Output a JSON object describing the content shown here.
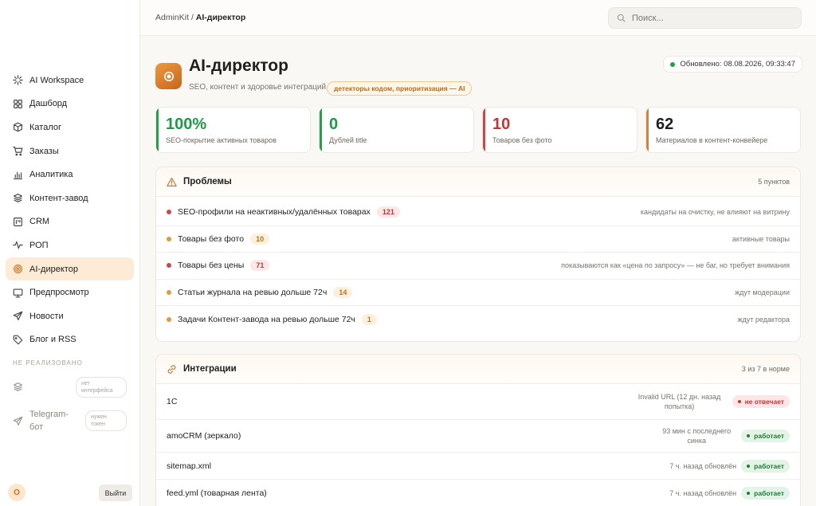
{
  "breadcrumb": {
    "root": "AdminKit",
    "sep": "/",
    "current": "AI-директор"
  },
  "search": {
    "placeholder": "Поиск..."
  },
  "sidebar": {
    "items": [
      {
        "label": "AI Workspace",
        "icon": "sparkle-icon"
      },
      {
        "label": "Дашборд",
        "icon": "grid-icon"
      },
      {
        "label": "Каталог",
        "icon": "box-icon"
      },
      {
        "label": "Заказы",
        "icon": "cart-icon"
      },
      {
        "label": "Аналитика",
        "icon": "bar-chart-icon"
      },
      {
        "label": "Контент-завод",
        "icon": "layers-icon"
      },
      {
        "label": "CRM",
        "icon": "kanban-icon"
      },
      {
        "label": "РОП",
        "icon": "pulse-icon"
      },
      {
        "label": "AI-директор",
        "icon": "target-icon"
      },
      {
        "label": "Предпросмотр",
        "icon": "monitor-icon"
      },
      {
        "label": "Новости",
        "icon": "send-icon"
      },
      {
        "label": "Блог и RSS",
        "icon": "tag-icon"
      }
    ],
    "active_index": 8,
    "section_label": "НЕ РЕАЛИЗОВАНО",
    "not_implemented": [
      {
        "label": "",
        "badge": "нет интерфейса",
        "icon": "layers-icon"
      },
      {
        "label": "Telegram-бот",
        "badge": "нужен токен",
        "icon": "send-icon"
      }
    ],
    "avatar_letter": "O",
    "logout_label": "Выйти"
  },
  "header": {
    "title": "AI-директор",
    "subtitle": "SEO, контент и здоровье интеграций",
    "pill": "детекторы кодом, приоритизация — AI",
    "updated": "Обновлено: 08.08.2026, 09:33:47"
  },
  "stats": [
    {
      "value": "100%",
      "label": "SEO-покрытие активных товаров",
      "accent": "#22a04a",
      "value_color": "#1d9a45"
    },
    {
      "value": "0",
      "label": "Дублей title",
      "accent": "#22a04a",
      "value_color": "#1d9a45"
    },
    {
      "value": "10",
      "label": "Товаров без фото",
      "accent": "#d04545",
      "value_color": "#c53434"
    },
    {
      "value": "62",
      "label": "Материалов в контент-конвейере",
      "accent": "#d2823a",
      "value_color": "#1f1f1f"
    }
  ],
  "problems": {
    "title": "Проблемы",
    "meta": "5 пунктов",
    "rows": [
      {
        "text": "SEO-профили на неактивных/удалённых товарах",
        "count": "121",
        "severity": "red",
        "note": "кандидаты на очистку, не влияют на витрину"
      },
      {
        "text": "Товары без фото",
        "count": "10",
        "severity": "orange",
        "note": "активные товары"
      },
      {
        "text": "Товары без цены",
        "count": "71",
        "severity": "red",
        "note": "показываются как «цена по запросу» — не баг, но требует внимания"
      },
      {
        "text": "Статьи журнала на ревью дольше 72ч",
        "count": "14",
        "severity": "orange",
        "note": "ждут модерации"
      },
      {
        "text": "Задачи Контент-завода на ревью дольше 72ч",
        "count": "1",
        "severity": "orange",
        "note": "ждут редактора"
      }
    ]
  },
  "integrations": {
    "title": "Интеграции",
    "meta": "3 из 7 в норме",
    "rows": [
      {
        "name": "1С",
        "note": "Invalid URL (12 дн. назад попытка)",
        "status": "не отвечает",
        "ok": false
      },
      {
        "name": "amoCRM (зеркало)",
        "note": "93 мин с последнего синка",
        "status": "работает",
        "ok": true
      },
      {
        "name": "sitemap.xml",
        "note": "7 ч. назад обновлён",
        "status": "работает",
        "ok": true
      },
      {
        "name": "feed.yml (товарная лента)",
        "note": "7 ч. назад обновлён",
        "status": "работает",
        "ok": true
      }
    ]
  },
  "colors": {
    "accent": "#d2823a",
    "ok": "#22a04a",
    "danger": "#d04545",
    "warn": "#e39a3c"
  }
}
